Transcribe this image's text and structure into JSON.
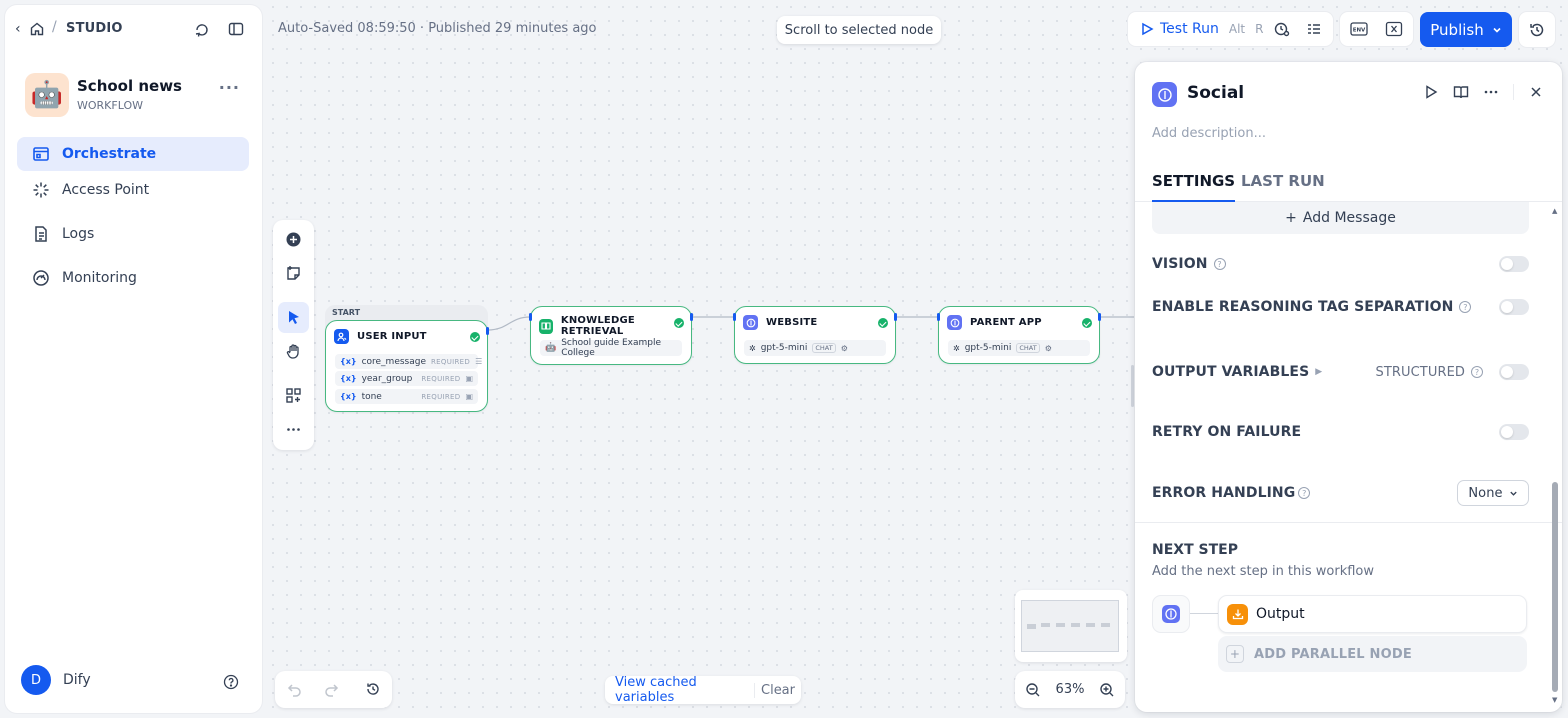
{
  "sidebar": {
    "breadcrumb": "STUDIO",
    "app": {
      "name": "School news",
      "type": "WORKFLOW",
      "avatar": "🤖"
    },
    "nav": [
      {
        "label": "Orchestrate",
        "icon": "orchestrate-icon",
        "active": true
      },
      {
        "label": "Access Point",
        "icon": "access-point-icon",
        "active": false
      },
      {
        "label": "Logs",
        "icon": "logs-icon",
        "active": false
      },
      {
        "label": "Monitoring",
        "icon": "monitoring-icon",
        "active": false
      }
    ],
    "user": {
      "initial": "D",
      "name": "Dify"
    }
  },
  "topbar": {
    "status": "Auto-Saved 08:59:50 · Published 29 minutes ago",
    "scroll_to_selected": "Scroll to selected node",
    "test_run": {
      "label": "Test Run",
      "shortcut_1": "Alt",
      "shortcut_2": "R"
    },
    "publish": "Publish"
  },
  "nodes": {
    "start_tag": "START",
    "user_input": {
      "title": "USER INPUT",
      "vars": [
        {
          "name": "core_message",
          "req": "REQUIRED"
        },
        {
          "name": "year_group",
          "req": "REQUIRED"
        },
        {
          "name": "tone",
          "req": "REQUIRED"
        }
      ]
    },
    "knowledge": {
      "title": "KNOWLEDGE RETRIEVAL",
      "dataset": "School guide Example College"
    },
    "website": {
      "title": "WEBSITE",
      "model": "gpt-5-mini",
      "chip": "CHAT"
    },
    "parent_app": {
      "title": "PARENT APP",
      "model": "gpt-5-mini",
      "chip": "CHAT"
    }
  },
  "bottom": {
    "view_cached": "View cached variables",
    "clear": "Clear",
    "zoom": "63%"
  },
  "panel": {
    "title": "Social",
    "description_placeholder": "Add description...",
    "tabs": [
      "SETTINGS",
      "LAST RUN"
    ],
    "add_message": "Add Message",
    "vision": "VISION",
    "reasoning": "ENABLE REASONING TAG SEPARATION",
    "output_vars": "OUTPUT VARIABLES",
    "structured": "STRUCTURED",
    "retry": "RETRY ON FAILURE",
    "error_handling": "ERROR HANDLING",
    "error_value": "None",
    "next_step_title": "NEXT STEP",
    "next_step_sub": "Add the next step in this workflow",
    "next_node": "Output",
    "add_parallel": "ADD PARALLEL NODE"
  },
  "colors": {
    "accent": "#155aef",
    "success": "#17b26a",
    "llm": "#6172f3",
    "output": "#f79009",
    "knowledge": "#17b26a"
  }
}
